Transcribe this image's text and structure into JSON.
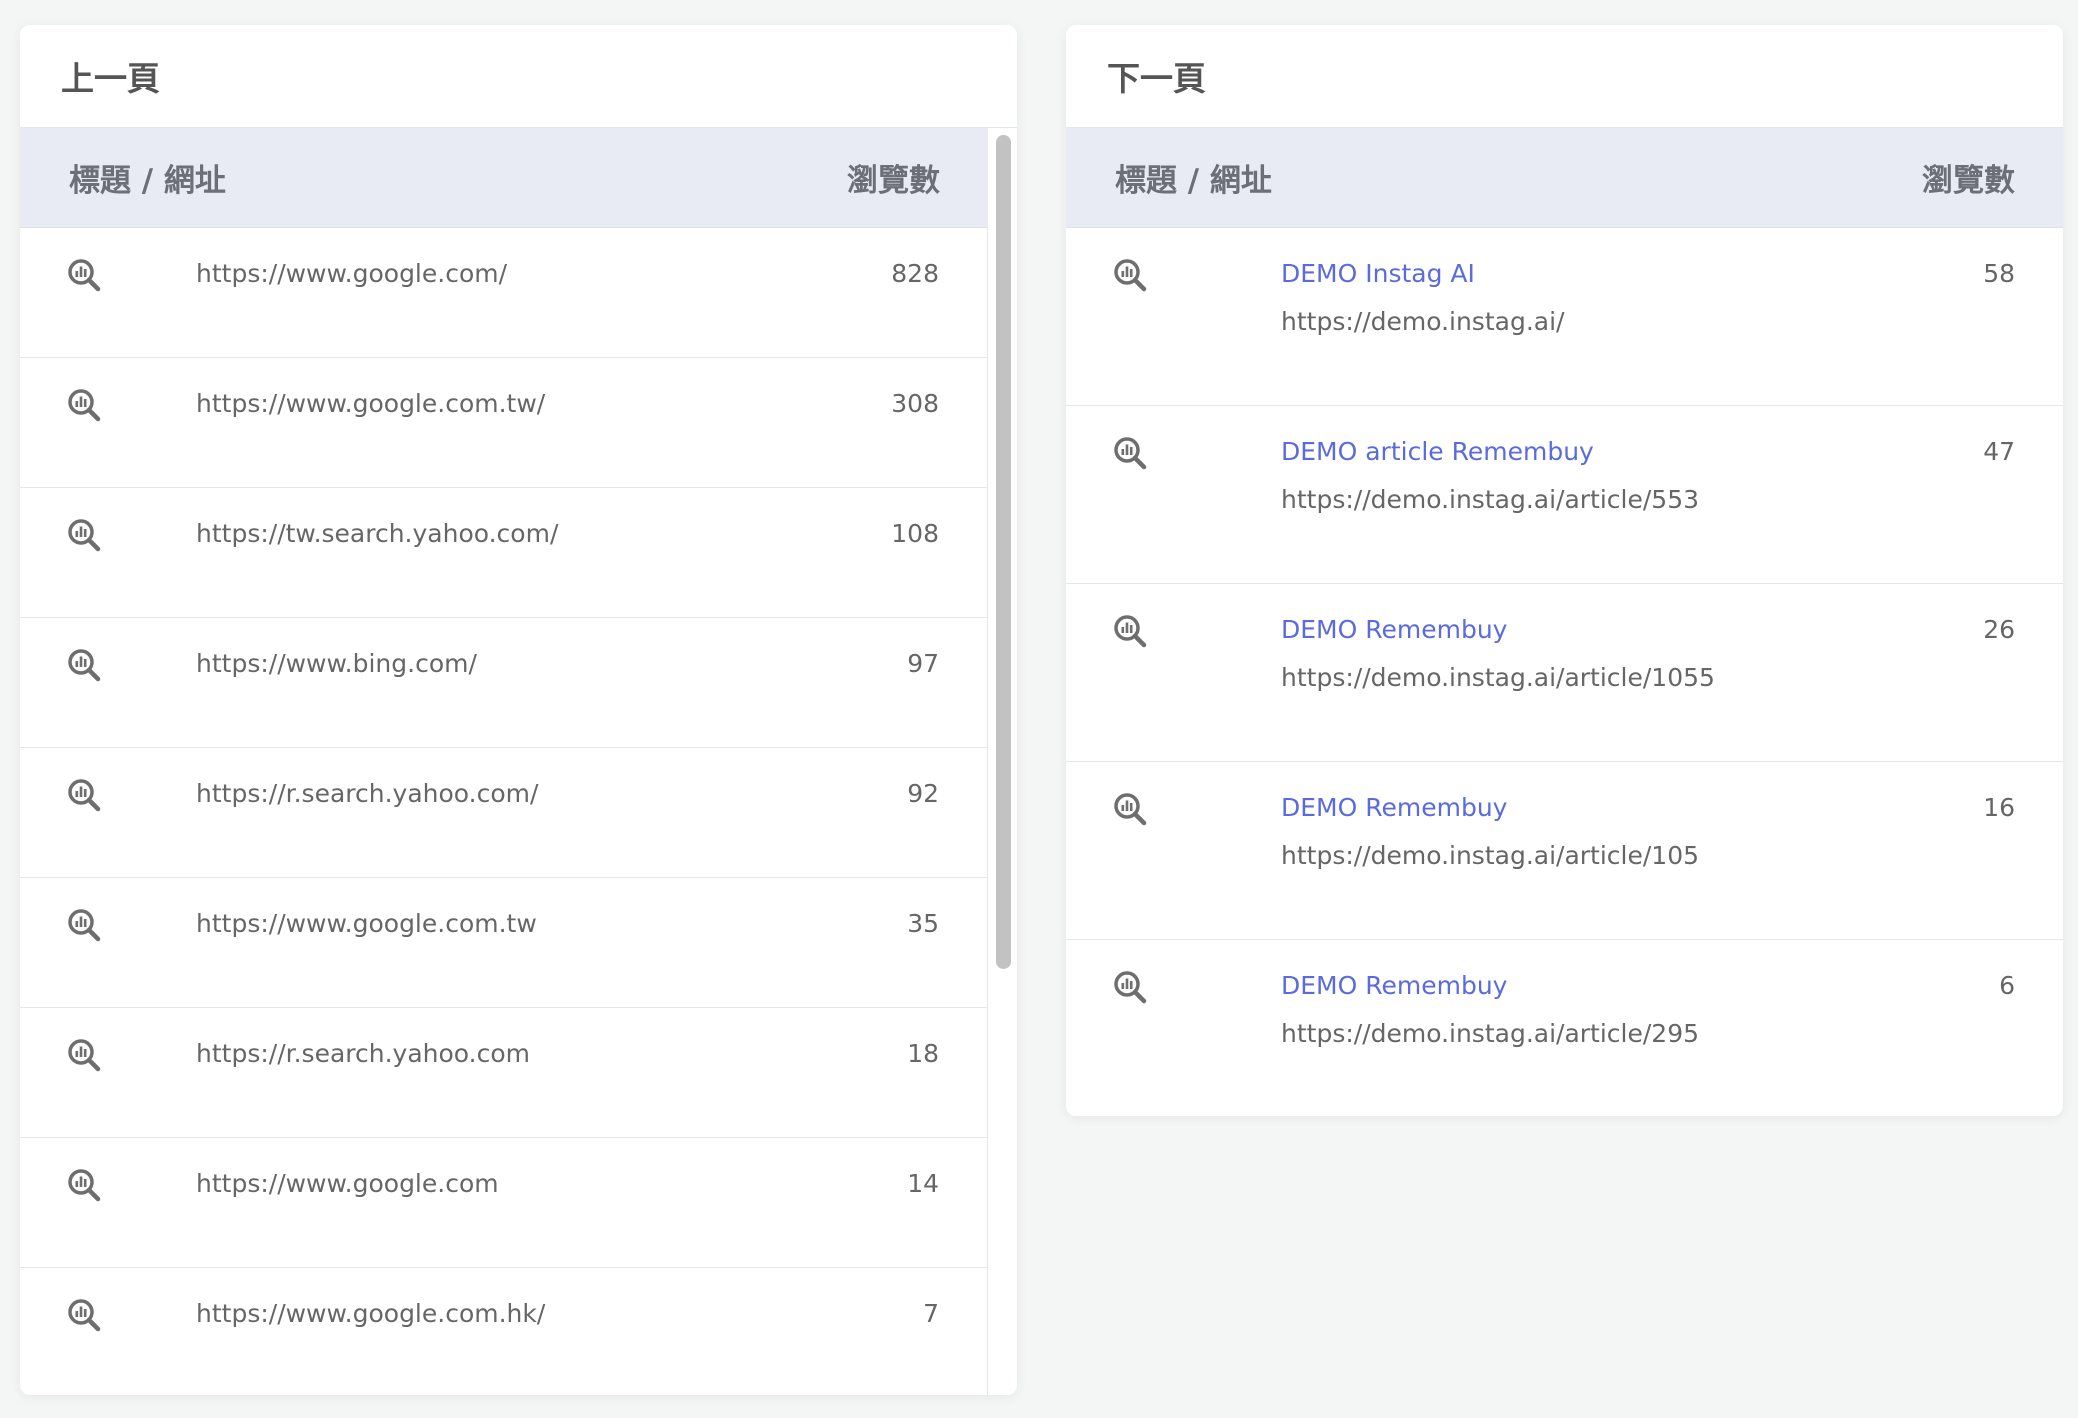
{
  "prev_panel": {
    "title": "上一頁",
    "col_title": "標題 / 網址",
    "col_views": "瀏覽數",
    "rows": [
      {
        "url": "https://www.google.com/",
        "views": "828"
      },
      {
        "url": "https://www.google.com.tw/",
        "views": "308"
      },
      {
        "url": "https://tw.search.yahoo.com/",
        "views": "108"
      },
      {
        "url": "https://www.bing.com/",
        "views": "97"
      },
      {
        "url": "https://r.search.yahoo.com/",
        "views": "92"
      },
      {
        "url": "https://www.google.com.tw",
        "views": "35"
      },
      {
        "url": "https://r.search.yahoo.com",
        "views": "18"
      },
      {
        "url": "https://www.google.com",
        "views": "14"
      },
      {
        "url": "https://www.google.com.hk/",
        "views": "7"
      }
    ]
  },
  "next_panel": {
    "title": "下一頁",
    "col_title": "標題 / 網址",
    "col_views": "瀏覽數",
    "rows": [
      {
        "title": "DEMO Instag AI",
        "url": "https://demo.instag.ai/",
        "views": "58"
      },
      {
        "title": "DEMO article Remembuy",
        "url": "https://demo.instag.ai/article/553",
        "views": "47"
      },
      {
        "title": "DEMO Remembuy",
        "url": "https://demo.instag.ai/article/1055",
        "views": "26"
      },
      {
        "title": "DEMO Remembuy",
        "url": "https://demo.instag.ai/article/105",
        "views": "16"
      },
      {
        "title": "DEMO Remembuy",
        "url": "https://demo.instag.ai/article/295",
        "views": "6"
      }
    ]
  },
  "colors": {
    "link": "#5b6bdf",
    "header_bg": "#e8ebf3",
    "icon": "#6e6e6e"
  },
  "icons": {
    "row_action": "search-analytics-icon"
  }
}
